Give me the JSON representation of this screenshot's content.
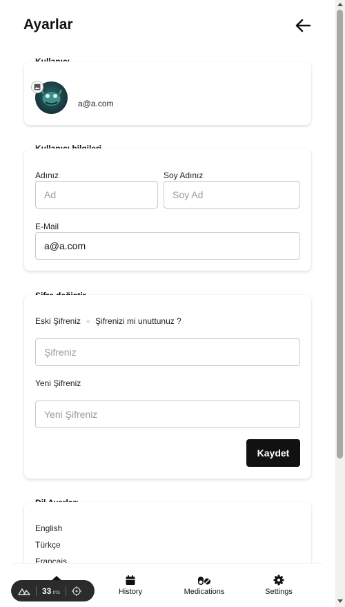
{
  "page": {
    "title": "Ayarlar"
  },
  "user_section": {
    "title": "Kullanıcı",
    "email": "a@a.com"
  },
  "user_info": {
    "title": "Kullanıcı bilgileri",
    "first_name_label": "Adınız",
    "first_name_placeholder": "Ad",
    "last_name_label": "Soy Adınız",
    "last_name_placeholder": "Soy Ad",
    "email_label": "E-Mail",
    "email_value": "a@a.com"
  },
  "password": {
    "title": "Şifre değiştir",
    "old_label": "Eski Şifreniz",
    "forgot_link": "Şifrenizi mi unuttunuz ?",
    "old_placeholder": "Şifreniz",
    "new_label": "Yeni Şifreniz",
    "new_placeholder": "Yeni Şifreniz",
    "save_label": "Kaydet"
  },
  "language": {
    "title": "Dil Ayarları",
    "options": [
      "English",
      "Türkçe",
      "Français"
    ]
  },
  "bottom_nav": {
    "items": [
      {
        "label": "History",
        "icon": "calendar-icon"
      },
      {
        "label": "Medications",
        "icon": "pills-icon"
      },
      {
        "label": "Settings",
        "icon": "gear-icon"
      }
    ]
  },
  "devtools": {
    "value": "33",
    "unit": "ms"
  }
}
